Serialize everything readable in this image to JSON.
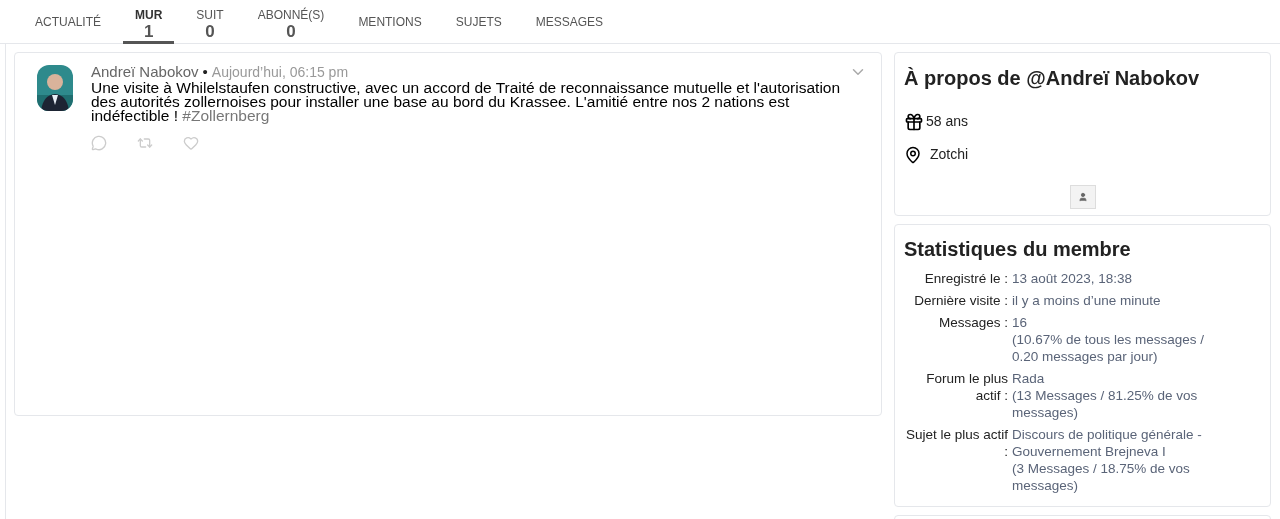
{
  "tabs": [
    {
      "label": "ACTUALITÉ",
      "selected": false
    },
    {
      "label": "MUR",
      "count": "1",
      "selected": true
    },
    {
      "label": "SUIT",
      "count": "0",
      "selected": false
    },
    {
      "label": "ABONNÉ(S)",
      "count": "0",
      "selected": false
    },
    {
      "label": "MENTIONS",
      "selected": false
    },
    {
      "label": "SUJETS",
      "selected": false
    },
    {
      "label": "MESSAGES",
      "selected": false
    }
  ],
  "post": {
    "author": "Andreï Nabokov",
    "separator": "•",
    "time": "Aujourd’hui, 06:15 pm",
    "text": "Une visite à Whilelstaufen constructive, avec un accord de Traité de reconnaissance mutuelle et l'autorisation des autorités zollernoises pour installer une base au bord du Krassee. L'amitié entre nos 2 nations est indéfectible !",
    "hashtag": "#Zollernberg"
  },
  "about": {
    "title": "À propos de @Andreï Nabokov",
    "age": "58 ans",
    "location": "Zotchi"
  },
  "stats": {
    "title": "Statistiques du membre",
    "rows": [
      {
        "label": "Enregistré le :",
        "values": [
          "13 août 2023, 18:38"
        ]
      },
      {
        "label": "Dernière visite :",
        "values": [
          "il y a moins d’une minute"
        ]
      },
      {
        "label": "Messages :",
        "values": [
          "16",
          "(10.67% de tous les messages / 0.20 messages par jour)"
        ]
      },
      {
        "label": "Forum le plus actif :",
        "values": [
          "Rada",
          "(13 Messages / 81.25% de vos messages)"
        ]
      },
      {
        "label": "Sujet le plus actif :",
        "values": [
          "Discours de politique générale - Gouvernement Brejneva I",
          "(3 Messages / 18.75% de vos messages)"
        ]
      }
    ]
  }
}
